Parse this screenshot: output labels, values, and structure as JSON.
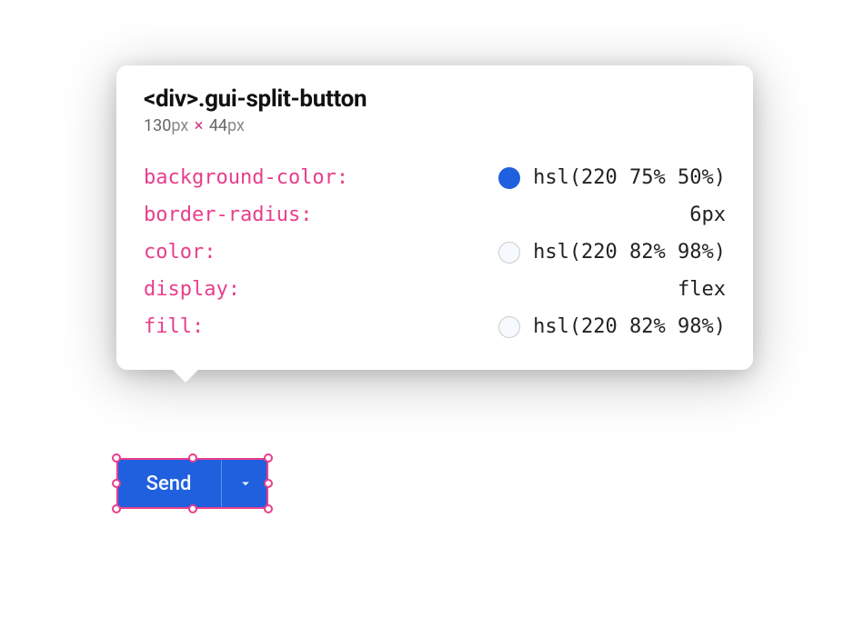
{
  "tooltip": {
    "selector": "<div>.gui-split-button",
    "width": "130",
    "height": "44",
    "unit": "px",
    "properties": [
      {
        "name": "background-color",
        "value": "hsl(220 75% 50%)",
        "swatch": "hsl(220, 75%, 50%)",
        "bordered": false
      },
      {
        "name": "border-radius",
        "value": "6px",
        "swatch": null
      },
      {
        "name": "color",
        "value": "hsl(220 82% 98%)",
        "swatch": "hsl(220, 82%, 98%)",
        "bordered": true
      },
      {
        "name": "display",
        "value": "flex",
        "swatch": null
      },
      {
        "name": "fill",
        "value": "hsl(220 82% 98%)",
        "swatch": "hsl(220, 82%, 98%)",
        "bordered": true
      }
    ]
  },
  "button": {
    "label": "Send"
  }
}
